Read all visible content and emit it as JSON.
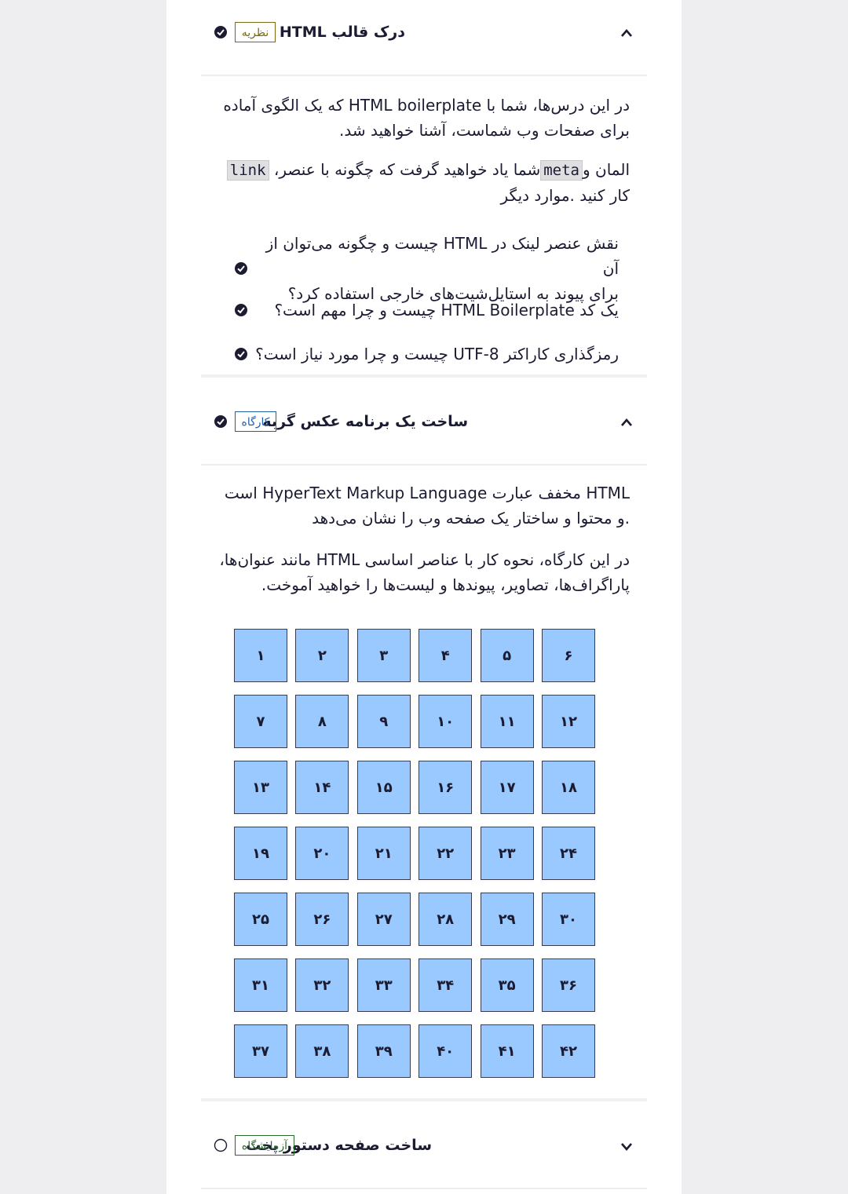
{
  "sections": [
    {
      "title": "درک قالب HTML",
      "badge": "نظریه",
      "badge_color": "#7a6a14",
      "status": "complete",
      "expanded": true
    },
    {
      "title": "ساخت یک برنامه عکس گربه",
      "badge": "کارگاه",
      "badge_color": "#1f5fa8",
      "status": "complete",
      "expanded": true
    },
    {
      "title": "ساخت صفحه دستور پخت",
      "badge": "آزمایشگاه",
      "badge_color": "#256a2a",
      "status": "incomplete",
      "expanded": false
    }
  ],
  "theory": {
    "intro": "در این درس‌ها، شما با HTML boilerplate که یک الگوی آماده\nبرای صفحات وب شماست، آشنا خواهید شد.",
    "elements_prefix": "المان و",
    "code_meta": "meta",
    "elements_mid": "شما یاد خواهید گرفت که چگونه با عنصر،",
    "code_link": "link",
    "elements_suffix": "کار کنید .موارد دیگر",
    "questions": [
      "نقش عنصر لینک در HTML چیست و چگونه می‌توان از آن\nبرای پیوند به استایل‌شیت‌های خارجی استفاده کرد؟",
      "یک کد HTML Boilerplate چیست و چرا مهم است؟",
      "رمزگذاری کاراکتر UTF-8 چیست و چرا مورد نیاز است؟"
    ]
  },
  "workshop": {
    "intro": "HTML مخفف عبارت HyperText Markup Language است\n.و محتوا و ساختار یک صفحه وب را نشان می‌دهد",
    "detail": "در این کارگاه، نحوه کار با عناصر اساسی HTML مانند عنوان‌ها،\nپاراگراف‌ها، تصاویر، پیوندها و لیست‌ها را خواهید آموخت.",
    "steps": [
      "۱",
      "۲",
      "۳",
      "۴",
      "۵",
      "۶",
      "۷",
      "۸",
      "۹",
      "۱۰",
      "۱۱",
      "۱۲",
      "۱۳",
      "۱۴",
      "۱۵",
      "۱۶",
      "۱۷",
      "۱۸",
      "۱۹",
      "۲۰",
      "۲۱",
      "۲۲",
      "۲۳",
      "۲۴",
      "۲۵",
      "۲۶",
      "۲۷",
      "۲۸",
      "۲۹",
      "۳۰",
      "۳۱",
      "۳۲",
      "۳۳",
      "۳۴",
      "۳۵",
      "۳۶",
      "۳۷",
      "۳۸",
      "۳۹",
      "۴۰",
      "۴۱",
      "۴۲"
    ]
  },
  "colors": {
    "step_fill": "#99c9ff",
    "step_border": "#3b3b4f"
  },
  "icons": {
    "expanded": "chevron-up-icon",
    "collapsed": "chevron-down-icon",
    "complete": "check-circle-icon",
    "incomplete": "empty-circle-icon"
  }
}
